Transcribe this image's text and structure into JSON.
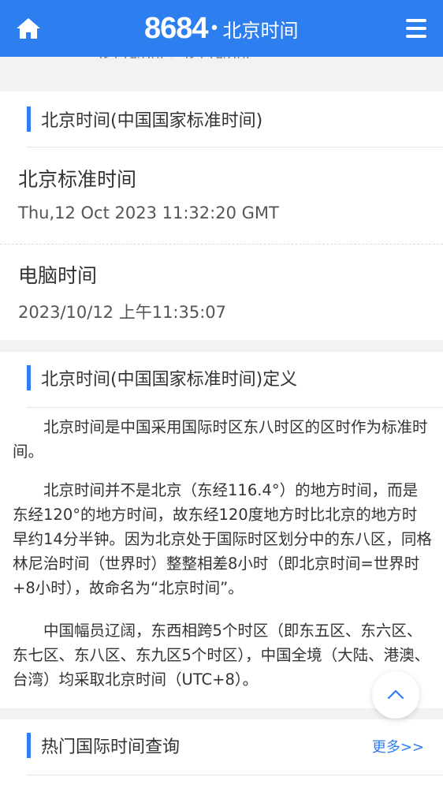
{
  "header": {
    "brand_logo": "8684",
    "brand_dot": "•",
    "brand_text": "北京时间",
    "home_icon": "home-icon",
    "menu_icon": "menu-icon",
    "color": "#2d7ff0"
  },
  "peek_text": "北京时间 · 北京时间",
  "beijing_section": {
    "title": "北京时间(中国国家标准时间)",
    "standard_label": "北京标准时间",
    "standard_value": "Thu,12 Oct 2023 11:32:20 GMT",
    "computer_label": "电脑时间",
    "computer_value": "2023/10/12 上午11:35:07"
  },
  "definition_section": {
    "title": "北京时间(中国国家标准时间)定义",
    "paragraphs": [
      "北京时间是中国采用国际时区东八时区的区时作为标准时间。",
      "北京时间并不是北京（东经116.4°）的地方时间，而是东经120°的地方时间，故东经120度地方时比北京的地方时早约14分半钟。因为北京处于国际时区划分中的东八区，同格林尼治时间（世界时）整整相差8小时（即北京时间=世界时+8小时），故命名为“北京时间”。",
      "中国幅员辽阔，东西相跨5个时区（即东五区、东六区、东七区、东八区、东九区5个时区），中国全境（大陆、港澳、台湾）均采取北京时间（UTC+8）。"
    ]
  },
  "hot_section": {
    "title": "热门国际时间查询",
    "more_label": "更多>>"
  },
  "scroll_top_icon": "chevron-up-icon"
}
